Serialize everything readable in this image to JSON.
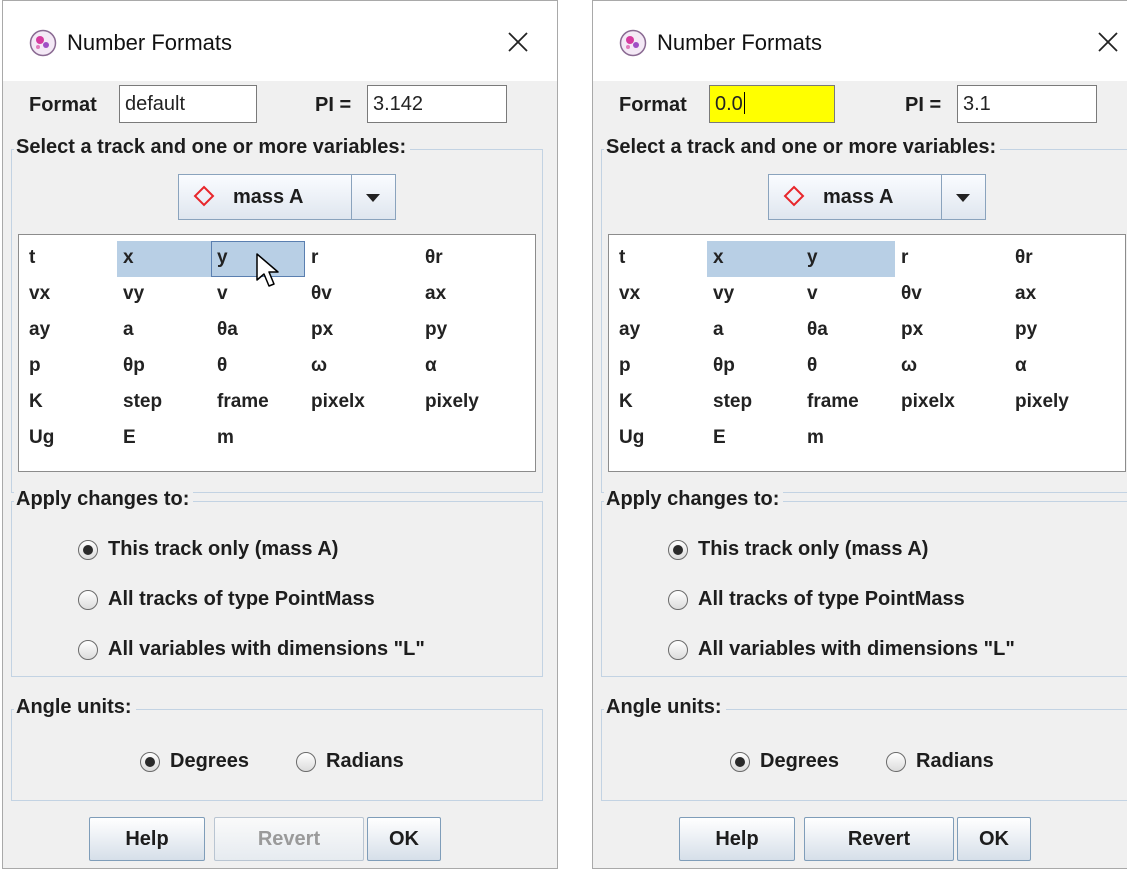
{
  "dialogs": [
    {
      "title": "Number Formats",
      "format_label": "Format",
      "format_value": "default",
      "pi_label": "PI =",
      "pi_value": "3.142",
      "select_group_title": "Select a track and one or more variables:",
      "track": "mass A",
      "track_icon": "red-diamond-icon",
      "variables": [
        [
          "t",
          "x",
          "y",
          "r",
          "θr"
        ],
        [
          "vx",
          "vy",
          "v",
          "θv",
          "ax"
        ],
        [
          "ay",
          "a",
          "θa",
          "px",
          "py"
        ],
        [
          "p",
          "θp",
          "θ",
          "ω",
          "α"
        ],
        [
          "K",
          "step",
          "frame",
          "pixelx",
          "pixely"
        ],
        [
          "Ug",
          "E",
          "m"
        ]
      ],
      "selected_variables": [
        "x",
        "y"
      ],
      "focused_variable": "y",
      "apply_group_title": "Apply changes to:",
      "apply_options": [
        "This track only (mass A)",
        "All tracks of type PointMass",
        "All variables with dimensions \"L\""
      ],
      "apply_selected": "This track only (mass A)",
      "angle_group_title": "Angle units:",
      "angle_options": [
        "Degrees",
        "Radians"
      ],
      "angle_selected": "Degrees",
      "buttons": {
        "help": "Help",
        "revert": "Revert",
        "ok": "OK"
      },
      "revert_enabled": false
    },
    {
      "title": "Number Formats",
      "format_label": "Format",
      "format_value": "0.0",
      "format_highlight": "#ffff00",
      "pi_label": "PI =",
      "pi_value": "3.1",
      "select_group_title": "Select a track and one or more variables:",
      "track": "mass A",
      "track_icon": "red-diamond-icon",
      "variables": [
        [
          "t",
          "x",
          "y",
          "r",
          "θr"
        ],
        [
          "vx",
          "vy",
          "v",
          "θv",
          "ax"
        ],
        [
          "ay",
          "a",
          "θa",
          "px",
          "py"
        ],
        [
          "p",
          "θp",
          "θ",
          "ω",
          "α"
        ],
        [
          "K",
          "step",
          "frame",
          "pixelx",
          "pixely"
        ],
        [
          "Ug",
          "E",
          "m"
        ]
      ],
      "selected_variables": [
        "x",
        "y"
      ],
      "apply_group_title": "Apply changes to:",
      "apply_options": [
        "This track only (mass A)",
        "All tracks of type PointMass",
        "All variables with dimensions \"L\""
      ],
      "apply_selected": "This track only (mass A)",
      "angle_group_title": "Angle units:",
      "angle_options": [
        "Degrees",
        "Radians"
      ],
      "angle_selected": "Degrees",
      "buttons": {
        "help": "Help",
        "revert": "Revert",
        "ok": "OK"
      },
      "revert_enabled": true
    }
  ],
  "colors": {
    "selection": "#b8cfe5",
    "track_marker": "#e8262b",
    "highlight_field": "#ffff00"
  }
}
